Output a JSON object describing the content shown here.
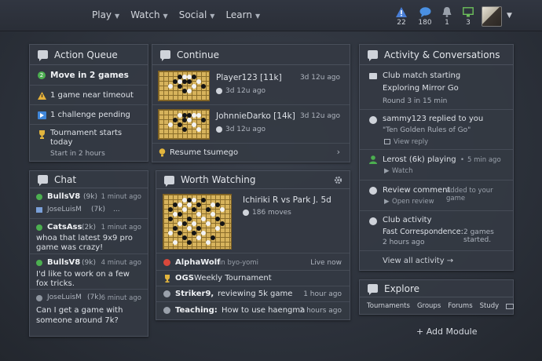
{
  "nav": [
    {
      "label": "Play"
    },
    {
      "label": "Watch"
    },
    {
      "label": "Social"
    },
    {
      "label": "Learn"
    }
  ],
  "notifications": [
    {
      "icon": "warning-icon",
      "count": "22",
      "color": "#4a7fd6"
    },
    {
      "icon": "chat-icon",
      "count": "180",
      "color": "#4a90e2"
    },
    {
      "icon": "bell-icon",
      "count": "1",
      "color": "#9aa1ab"
    },
    {
      "icon": "monitor-icon",
      "count": "3",
      "color": "#6cbf5b"
    }
  ],
  "action_queue": {
    "title": "Action Queue",
    "items": [
      {
        "icon": "number-badge-icon",
        "badge": "2",
        "text": "Move in 2 games"
      },
      {
        "icon": "warning-icon",
        "text": "1 game near timeout"
      },
      {
        "icon": "flag-icon",
        "text": "1 challenge pending"
      },
      {
        "icon": "trophy-icon",
        "text": "Tournament starts today",
        "sub": "Start in 2 hours"
      }
    ]
  },
  "chat": {
    "title": "Chat",
    "messages": [
      {
        "user": "BullsV8",
        "rank": "(9k)",
        "time": "1 minut ago",
        "text": "",
        "extra_user": "JoseLuisM",
        "extra_rank": "(7k)",
        "extra_text": "..."
      },
      {
        "user": "CatsAss",
        "rank": "(2k)",
        "time": "1 minut ago",
        "text": "whoa that latest 9x9 pro game was crazy!"
      },
      {
        "user": "BullsV8",
        "rank": "(9k)",
        "time": "4 minut ago",
        "text": "I'd like to work on a few fox tricks."
      },
      {
        "user": "JoseLuisM",
        "rank": "(7k)",
        "time": "6 minut ago",
        "text": "Can I get a game with someone around 7k?"
      }
    ]
  },
  "continue": {
    "title": "Continue",
    "games": [
      {
        "player": "Player123 [11k]",
        "time": "3d 12u ago",
        "clock": "3d 12u ago"
      },
      {
        "player": "JohnnieDarko [14k]",
        "time": "3d 12u ago",
        "clock": "3d 12u ago"
      }
    ],
    "resume": "Resume tsumego"
  },
  "worth_watching": {
    "title": "Worth Watching",
    "featured": {
      "title": "Ichiriki R vs Park J. 5d",
      "moves": "186 moves"
    },
    "items": [
      {
        "icon": "live-icon",
        "user": "AlphaWolf",
        "detail": "in byo-yomi",
        "time": "Live now"
      },
      {
        "icon": "trophy-icon",
        "user": "OGS",
        "detail": "Weekly Tournament",
        "time": ""
      },
      {
        "icon": "comment-icon",
        "user": "Striker9,",
        "detail": "reviewing 5k game",
        "time": "1 hour ago"
      },
      {
        "icon": "comment-icon",
        "user": "Teaching:",
        "detail": "How to use haengma",
        "time": "2 hours ago"
      }
    ]
  },
  "activity": {
    "title": "Activity & Conversations",
    "items": [
      {
        "icon": "bubble-icon",
        "line1": "Club match starting",
        "line2": "Exploring Mirror Go",
        "line3": "Round 3 in 15 min"
      },
      {
        "icon": "comment-icon",
        "line1": "sammy123 replied to you",
        "line2": "\"Ten Golden Rules of Go\"",
        "line3": "View reply"
      },
      {
        "icon": "user-icon",
        "line1": "Lerost (6k) playing",
        "time": "5 min ago",
        "line3": "Watch"
      },
      {
        "icon": "comment-icon",
        "line1": "Review comment",
        "line1b": "added to your game",
        "line3": "Open review"
      },
      {
        "icon": "club-icon",
        "line1": "Club activity",
        "line2a": "Fast Correspondence:",
        "line2b": "2 games started.",
        "line3": "2 hours ago"
      }
    ],
    "view_all": "View all activity →"
  },
  "explore": {
    "title": "Explore",
    "links": [
      "Tournaments",
      "Groups",
      "Forums",
      "Study"
    ]
  },
  "add_module": "+ Add Module"
}
